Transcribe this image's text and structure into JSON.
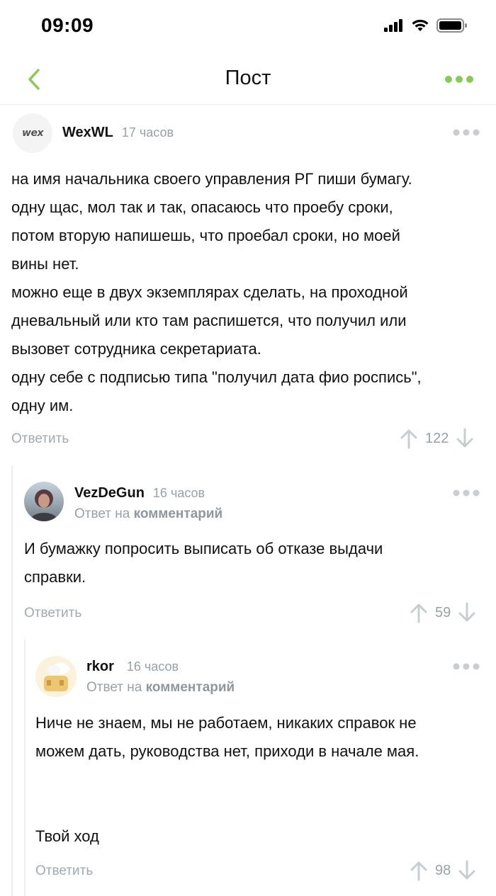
{
  "status_bar": {
    "time": "09:09"
  },
  "nav": {
    "title": "Пост"
  },
  "comments": [
    {
      "author": "WexWL",
      "time": "17 часов",
      "avatar_text": "wex",
      "lines": [
        "на имя начальника своего управления РГ пиши бумагу.",
        "одну щас, мол так и так, опасаюсь что проебу сроки,",
        "потом вторую напишешь, что проебал сроки, но моей",
        "вины нет.",
        "можно еще в двух экземплярах сделать, на проходной",
        "дневальный или кто там распишется, что получил или",
        "вызовет сотрудника секретариата.",
        "одну себе с подписью типа \"получил дата фио роспись\",",
        "одну им."
      ],
      "reply_label": "Ответить",
      "rating": "122"
    },
    {
      "author": "VezDeGun",
      "time": "16 часов",
      "reply_to_prefix": "Ответ на",
      "reply_to_link": "комментарий",
      "lines": [
        "И бумажку попросить выписать об отказе выдачи",
        "справки."
      ],
      "reply_label": "Ответить",
      "rating": "59"
    },
    {
      "author": "rkor",
      "time": "16 часов",
      "reply_to_prefix": "Ответ на",
      "reply_to_link": "комментарий",
      "lines": [
        "Ниче не знаем, мы не работаем, никаких справок не",
        "можем дать, руководства нет, приходи в начале мая.",
        "",
        "",
        "Твой ход"
      ],
      "reply_label": "Ответить",
      "rating": "98"
    }
  ],
  "colors": {
    "accent": "#8ac858",
    "muted": "#9aa0a6",
    "divider": "#ececec"
  }
}
